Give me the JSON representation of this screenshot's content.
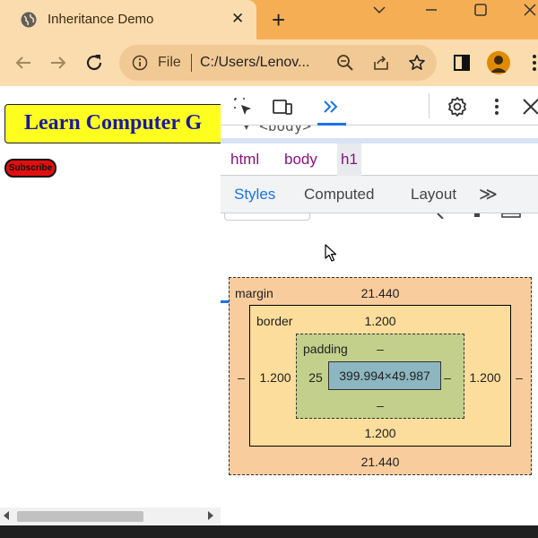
{
  "browser": {
    "tab_title": "Inheritance Demo",
    "tab_close": "✕",
    "new_tab": "+",
    "address": {
      "scheme_label": "File",
      "url": "C:/Users/Lenov..."
    }
  },
  "page": {
    "heading": "Learn Computer G",
    "subscribe_label": "Subscribe"
  },
  "devtools": {
    "dom_peek": "▾ <body>",
    "breadcrumbs": [
      "html",
      "body",
      "h1"
    ],
    "subtabs": [
      "Styles",
      "Computed",
      "Layout"
    ],
    "more_tabs": "≫",
    "box_model": {
      "margin_label": "margin",
      "margin_top": "21.440",
      "margin_bottom": "21.440",
      "margin_left": "–",
      "margin_right": "–",
      "border_label": "border",
      "border_top": "1.200",
      "border_bottom": "1.200",
      "border_left": "1.200",
      "border_right": "1.200",
      "padding_label": "padding",
      "padding_top": "–",
      "padding_bottom": "–",
      "padding_left": "25",
      "padding_right": "–",
      "content_size": "399.994×49.987"
    }
  },
  "colors": {
    "titlebar": "#f6ae55",
    "toolbar": "#fbdcae",
    "heading_bg": "#ffff1f",
    "heading_text": "#1a1aa0",
    "subscribe_bg": "#e01010",
    "margin_box": "#f9cc9d",
    "border_box": "#fddd9b",
    "padding_box": "#c3d08b",
    "content_box": "#8cb6c0",
    "accent": "#1a73e8"
  },
  "icons": [
    "globe-icon",
    "close-icon",
    "plus-icon",
    "minimize-icon",
    "maximize-icon",
    "window-close-icon",
    "back-icon",
    "forward-icon",
    "reload-icon",
    "info-icon",
    "zoom-icon",
    "share-icon",
    "star-icon",
    "sidepanel-icon",
    "profile-icon",
    "menu-icon",
    "inspect-icon",
    "device-toolbar-icon",
    "more-panels-icon",
    "settings-gear-icon",
    "kebab-menu-icon"
  ]
}
